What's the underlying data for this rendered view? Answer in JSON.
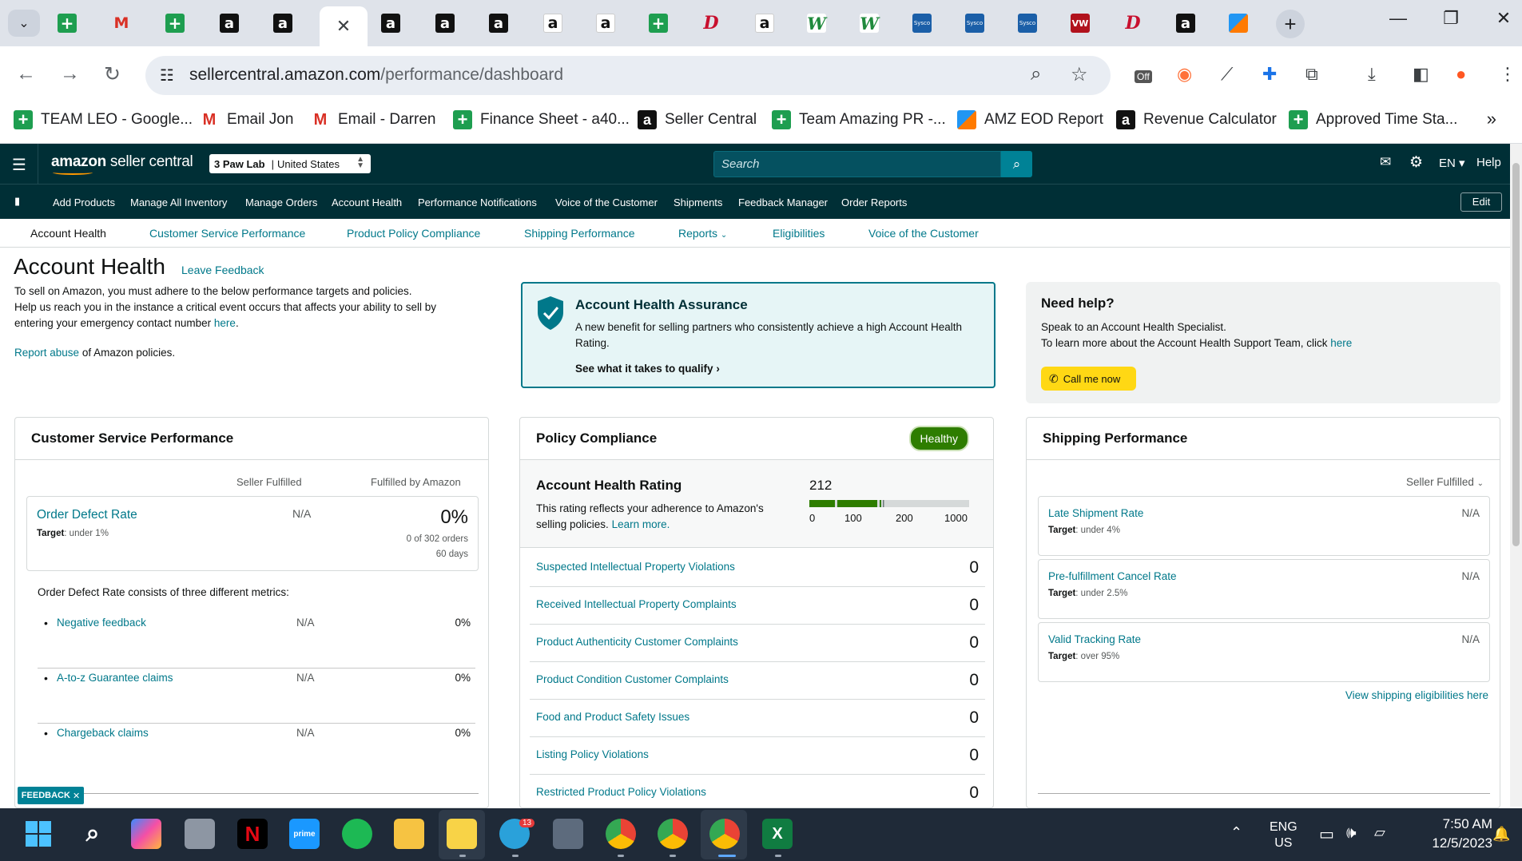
{
  "browser": {
    "url_domain": "sellercentral.amazon.com",
    "url_path": "/performance/dashboard",
    "ext_off_label": "Off",
    "bookmarks": [
      {
        "icon": "sheets-icon",
        "label": "TEAM LEO - Google..."
      },
      {
        "icon": "gmail-icon",
        "label": "Email Jon"
      },
      {
        "icon": "gmail-icon",
        "label": "Email - Darren"
      },
      {
        "icon": "sheets-icon",
        "label": "Finance Sheet - a40..."
      },
      {
        "icon": "amazon-icon",
        "label": "Seller Central"
      },
      {
        "icon": "sheets-icon",
        "label": "Team Amazing PR -..."
      },
      {
        "icon": "pen-icon",
        "label": "AMZ EOD Report"
      },
      {
        "icon": "amazon-icon",
        "label": "Revenue Calculator"
      },
      {
        "icon": "sheets-icon",
        "label": "Approved Time Sta..."
      }
    ]
  },
  "header": {
    "logo_bold": "amazon",
    "logo_text": " seller central",
    "store_name": "3 Paw Lab",
    "store_region": "United States",
    "search_placeholder": "Search",
    "language": "EN",
    "help": "Help"
  },
  "nav": {
    "links": [
      "Add Products",
      "Manage All Inventory",
      "Manage Orders",
      "Account Health",
      "Performance Notifications",
      "Voice of the Customer",
      "Shipments",
      "Feedback Manager",
      "Order Reports"
    ],
    "edit": "Edit"
  },
  "subnav": {
    "tabs": [
      "Account Health",
      "Customer Service Performance",
      "Product Policy Compliance",
      "Shipping Performance",
      "Reports",
      "Eligibilities",
      "Voice of the Customer"
    ]
  },
  "page": {
    "title": "Account Health",
    "leave_feedback": "Leave Feedback",
    "intro_1": "To sell on Amazon, you must adhere to the below performance targets and policies.",
    "intro_2": "Help us reach you in the instance a critical event occurs that affects your ability to sell by entering your emergency contact number",
    "intro_link": "here",
    "report_link": "Report abuse",
    "report_rest": " of Amazon policies."
  },
  "aha": {
    "title": "Account Health Assurance",
    "desc": "A new benefit for selling partners who consistently achieve a high Account Health Rating.",
    "link": "See what it takes to qualify"
  },
  "help": {
    "title": "Need help?",
    "line1": "Speak to an Account Health Specialist.",
    "line2": "To learn more about the Account Health Support Team, click",
    "line2_link": "here",
    "call_btn": "Call me now"
  },
  "csp": {
    "title": "Customer Service Performance",
    "col_sf": "Seller Fulfilled",
    "col_fba": "Fulfilled by Amazon",
    "odr_name": "Order Defect Rate",
    "odr_target_label": "Target",
    "odr_target": ": under 1%",
    "odr_sf": "N/A",
    "odr_fba": "0%",
    "odr_orders": "0 of 302 orders",
    "odr_days": "60 days",
    "note": "Order Defect Rate consists of three different metrics:",
    "metrics": [
      {
        "name": "Negative feedback",
        "sf": "N/A",
        "fba": "0%"
      },
      {
        "name": "A-to-z Guarantee claims",
        "sf": "N/A",
        "fba": "0%"
      },
      {
        "name": "Chargeback claims",
        "sf": "N/A",
        "fba": "0%"
      }
    ]
  },
  "policy": {
    "title": "Policy Compliance",
    "status": "Healthy",
    "ahr_title": "Account Health Rating",
    "ahr_desc": "This rating reflects your adherence to Amazon's selling policies.",
    "ahr_link": "Learn more.",
    "ahr_score": "212",
    "ahr_fraction": 0.212,
    "ticks": [
      "0",
      "100",
      "200",
      "1000"
    ],
    "violations": [
      {
        "name": "Suspected Intellectual Property Violations",
        "count": "0"
      },
      {
        "name": "Received Intellectual Property Complaints",
        "count": "0"
      },
      {
        "name": "Product Authenticity Customer Complaints",
        "count": "0"
      },
      {
        "name": "Product Condition Customer Complaints",
        "count": "0"
      },
      {
        "name": "Food and Product Safety Issues",
        "count": "0"
      },
      {
        "name": "Listing Policy Violations",
        "count": "0"
      },
      {
        "name": "Restricted Product Policy Violations",
        "count": "0"
      }
    ]
  },
  "shipping": {
    "title": "Shipping Performance",
    "selector": "Seller Fulfilled",
    "target_label": "Target",
    "metrics": [
      {
        "name": "Late Shipment Rate",
        "target": ": under 4%",
        "value": "N/A"
      },
      {
        "name": "Pre-fulfillment Cancel Rate",
        "target": ": under 2.5%",
        "value": "N/A"
      },
      {
        "name": "Valid Tracking Rate",
        "target": ": over 95%",
        "value": "N/A"
      }
    ],
    "link": "View shipping eligibilities here"
  },
  "feedback_tab": "FEEDBACK",
  "taskbar": {
    "telegram_badge": "13",
    "lang1": "ENG",
    "lang2": "US",
    "time": "7:50 AM",
    "date": "12/5/2023"
  },
  "colors": {
    "header_bg": "#002f36",
    "link": "#00788a",
    "healthy": "#2e7d00",
    "call_btn": "#ffd814"
  }
}
